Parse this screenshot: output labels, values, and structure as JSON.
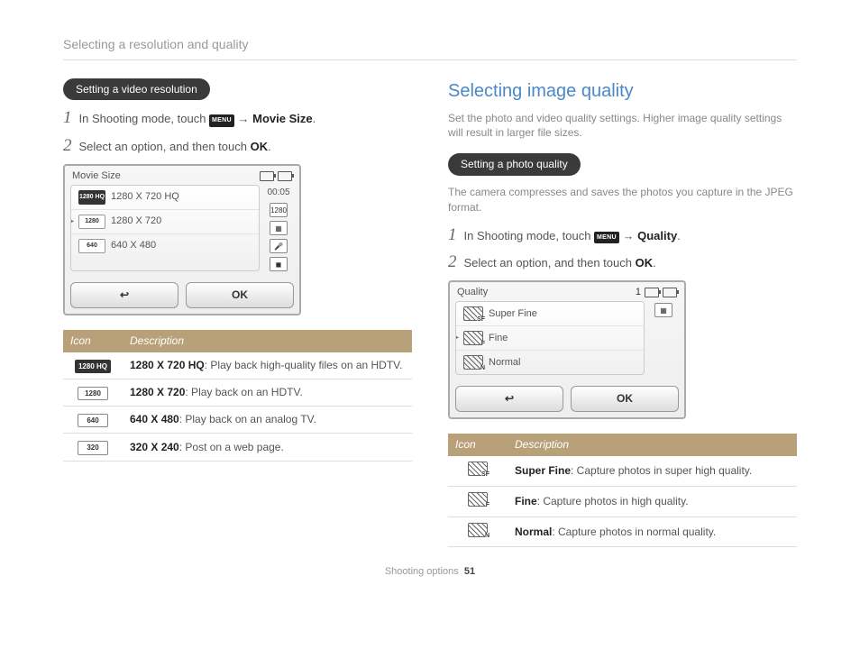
{
  "header": "Selecting a resolution and quality",
  "left": {
    "pill": "Setting a video resolution",
    "step1_a": "In Shooting mode, touch ",
    "menu_icon": "MENU",
    "step1_arrow": " → ",
    "step1_bold": "Movie Size",
    "step1_end": ".",
    "step2_a": "Select an option, and then touch ",
    "ok_label": "OK",
    "step2_end": ".",
    "screen": {
      "title": "Movie Size",
      "timer": "00:05",
      "side_label": "1280",
      "options": [
        {
          "icon": "1280\nHQ",
          "dark": true,
          "label": "1280 X 720 HQ"
        },
        {
          "icon": "1280",
          "dark": false,
          "label": "1280 X 720",
          "selected": true
        },
        {
          "icon": "640",
          "dark": false,
          "label": "640 X 480"
        }
      ],
      "ok": "OK"
    },
    "table_h1": "Icon",
    "table_h2": "Description",
    "rows": [
      {
        "icon": "1280\nHQ",
        "dark": true,
        "bold": "1280 X 720 HQ",
        "rest": ": Play back high-quality files on an HDTV."
      },
      {
        "icon": "1280",
        "dark": false,
        "bold": "1280 X 720",
        "rest": ": Play back on an HDTV."
      },
      {
        "icon": "640",
        "dark": false,
        "bold": "640 X 480",
        "rest": ": Play back on an analog TV."
      },
      {
        "icon": "320",
        "dark": false,
        "bold": "320 X 240",
        "rest": ": Post on a web page."
      }
    ]
  },
  "right": {
    "title": "Selecting image quality",
    "intro": "Set the photo and video quality settings. Higher image quality settings will result in larger file sizes.",
    "pill": "Setting a photo quality",
    "pill_desc": "The camera compresses and saves the photos you capture in the JPEG format.",
    "step1_a": "In Shooting mode, touch ",
    "menu_icon": "MENU",
    "step1_arrow": " → ",
    "step1_bold": "Quality",
    "step1_end": ".",
    "step2_a": "Select an option, and then touch ",
    "ok_label": "OK",
    "step2_end": ".",
    "screen": {
      "title": "Quality",
      "count": "1",
      "options": [
        {
          "sub": "SF",
          "label": "Super Fine"
        },
        {
          "sub": "F",
          "label": "Fine",
          "selected": true
        },
        {
          "sub": "N",
          "label": "Normal"
        }
      ],
      "ok": "OK"
    },
    "table_h1": "Icon",
    "table_h2": "Description",
    "rows": [
      {
        "sub": "SF",
        "bold": "Super Fine",
        "rest": ": Capture photos in super high quality."
      },
      {
        "sub": "F",
        "bold": "Fine",
        "rest": ": Capture photos in high quality."
      },
      {
        "sub": "N",
        "bold": "Normal",
        "rest": ": Capture photos in normal quality."
      }
    ]
  },
  "footer_section": "Shooting options",
  "footer_page": "51"
}
